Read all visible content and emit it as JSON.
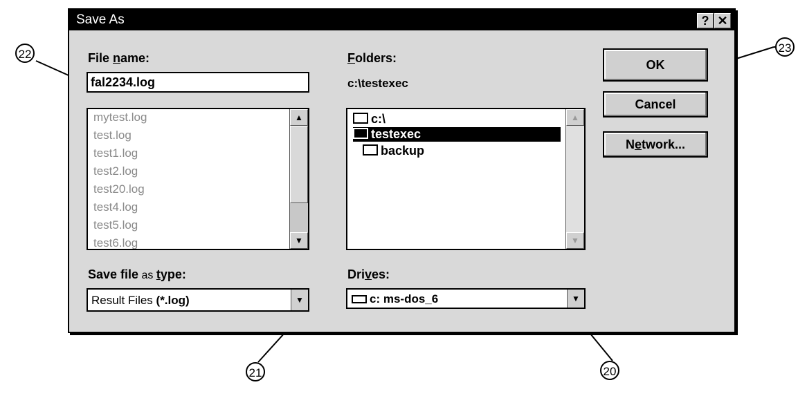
{
  "dialog": {
    "title": "Save As",
    "help_glyph": "?",
    "close_glyph": "✕",
    "file_name_label_prefix": "File ",
    "file_name_label_u": "n",
    "file_name_label_suffix": "ame:",
    "file_name_value": "fal2234.log",
    "file_list": [
      "mytest.log",
      "test.log",
      "test1.log",
      "test2.log",
      "test20.log",
      "test4.log",
      "test5.log",
      "test6.log"
    ],
    "folders_label_u": "F",
    "folders_label_suffix": "olders:",
    "current_path": "c:\\testexec",
    "folder_tree": [
      "c:\\",
      "testexec",
      "backup"
    ],
    "save_type_label_a": "Save file",
    "save_type_label_b": " as ",
    "save_type_label_u": "t",
    "save_type_label_c": "ype:",
    "save_type_value_a": "Result Files ",
    "save_type_value_b": "(*.log)",
    "drives_label_a": "Dri",
    "drives_label_u": "v",
    "drives_label_b": "es:",
    "drive_value": "c: ms-dos_6",
    "ok_label": "OK",
    "cancel_label": "Cancel",
    "network_a": "N",
    "network_u": "e",
    "network_b": "twork..."
  },
  "callouts": [
    "22",
    "23",
    "21",
    "20"
  ],
  "icons": [
    "help-icon",
    "close-icon",
    "scroll-up-icon",
    "scroll-down-icon",
    "folder-icon",
    "drive-icon",
    "dropdown-arrow-icon"
  ]
}
